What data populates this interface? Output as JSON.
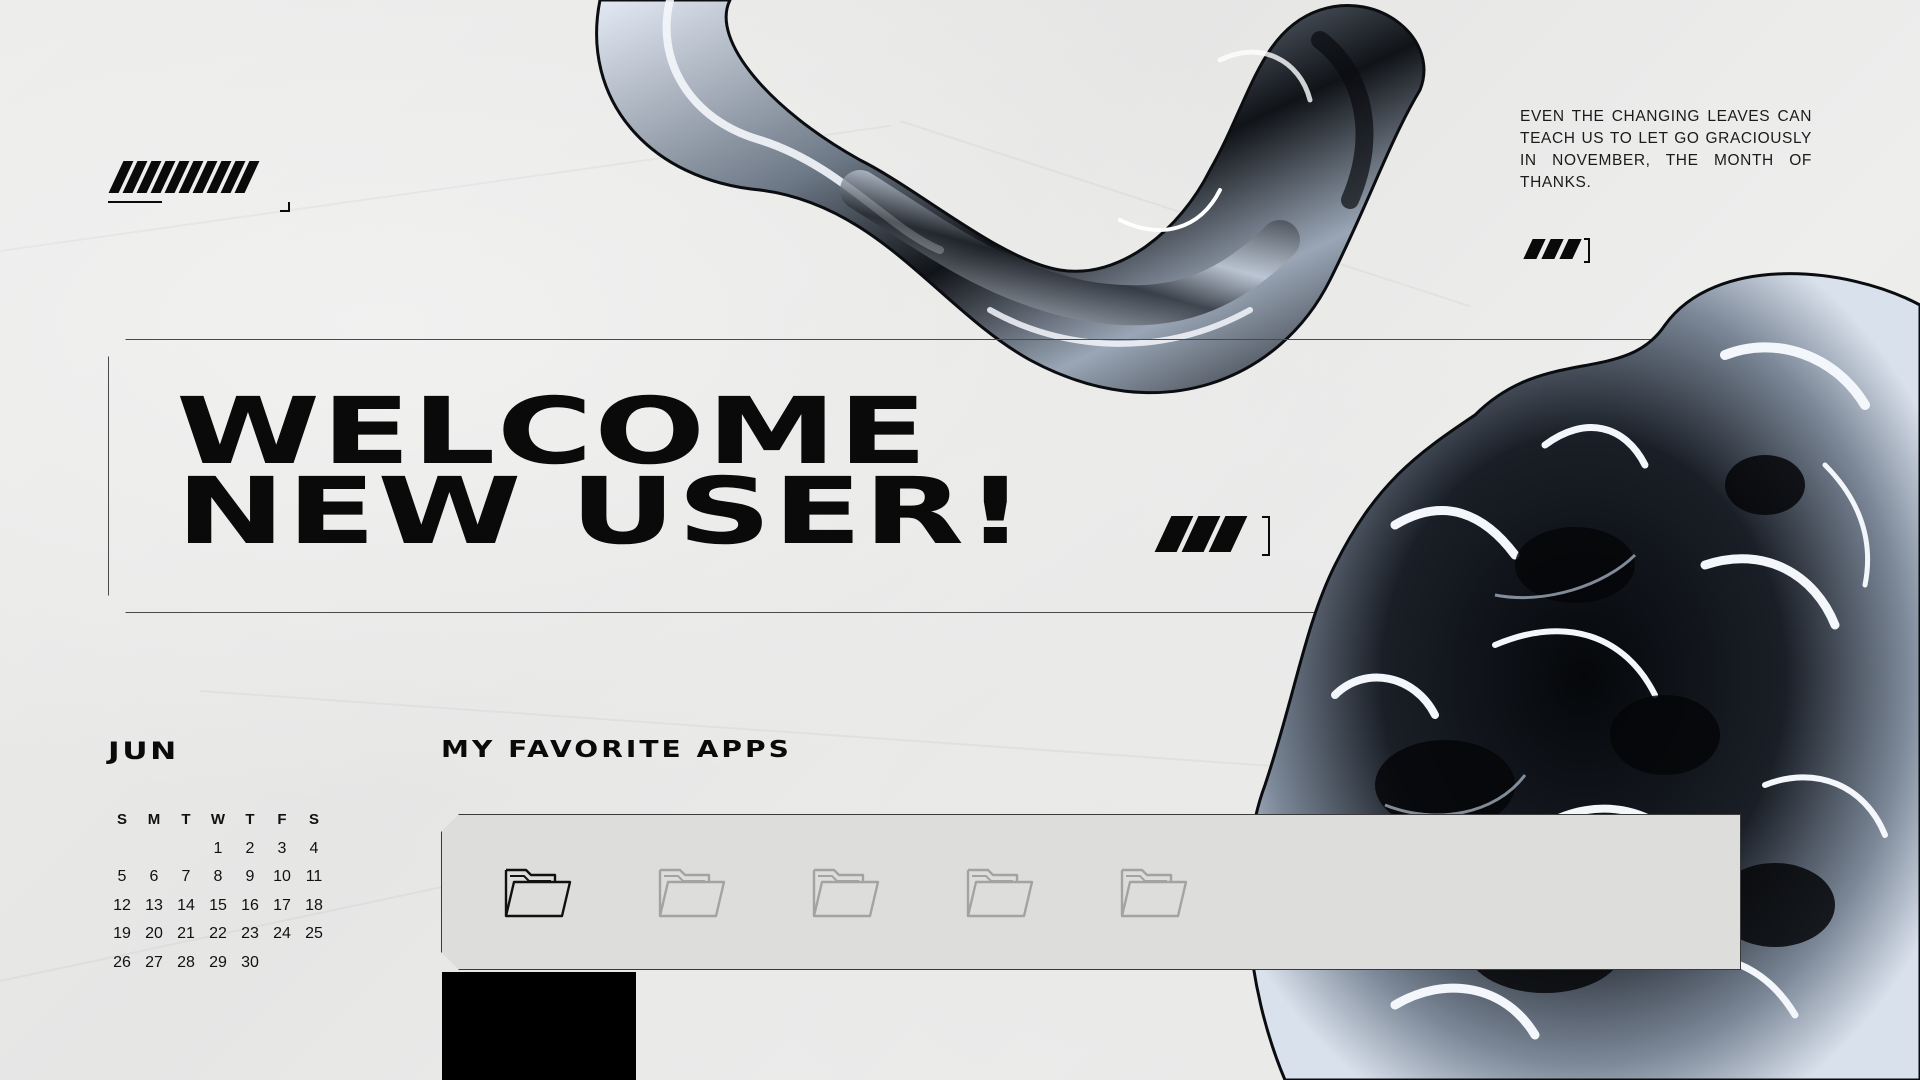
{
  "welcome": {
    "line1": "WELCOME",
    "line2": "NEW USER!"
  },
  "quote": {
    "text": "EVEN THE CHANGING LEAVES CAN TEACH US TO LET GO GRACIOUSLY IN NOVEMBER, THE MONTH OF THANKS."
  },
  "calendar": {
    "month": "JUN",
    "weekdays": [
      "S",
      "M",
      "T",
      "W",
      "T",
      "F",
      "S"
    ],
    "weeks": [
      [
        "",
        "",
        "",
        "1",
        "2",
        "3",
        "4"
      ],
      [
        "5",
        "6",
        "7",
        "8",
        "9",
        "10",
        "11"
      ],
      [
        "12",
        "13",
        "14",
        "15",
        "16",
        "17",
        "18"
      ],
      [
        "19",
        "20",
        "21",
        "22",
        "23",
        "24",
        "25"
      ],
      [
        "26",
        "27",
        "28",
        "29",
        "30",
        "",
        ""
      ]
    ]
  },
  "apps": {
    "title": "MY FAVORITE APPS",
    "items": [
      {
        "icon": "folder-icon",
        "active": true
      },
      {
        "icon": "folder-icon",
        "active": false
      },
      {
        "icon": "folder-icon",
        "active": false
      },
      {
        "icon": "folder-icon",
        "active": false
      },
      {
        "icon": "folder-icon",
        "active": false
      }
    ]
  },
  "colors": {
    "background": "#e8e8e7",
    "ink": "#0a0a0a",
    "folder_active": "#111111",
    "folder_inactive": "#a3a3a3",
    "chrome_highlight": "#dfe6f1"
  }
}
